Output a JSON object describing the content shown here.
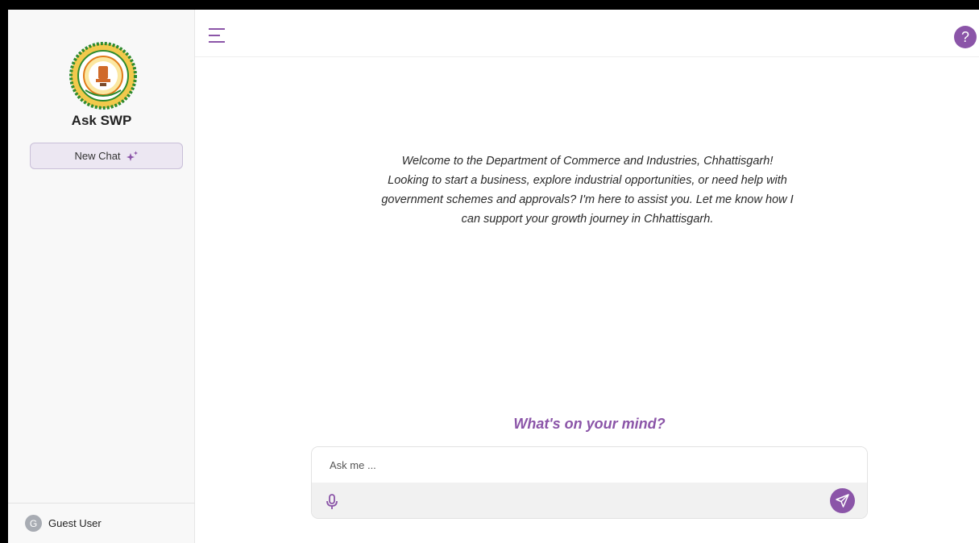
{
  "app": {
    "title": "Ask SWP",
    "new_chat_label": "New Chat"
  },
  "user": {
    "initial": "G",
    "name": "Guest User"
  },
  "header": {
    "help_symbol": "?"
  },
  "welcome": {
    "line1": "Welcome to the Department of Commerce and Industries, Chhattisgarh!",
    "line2": "Looking to start a business, explore industrial opportunities, or need help with",
    "line3": "government schemes and approvals? I'm here to assist you. Let me know how I",
    "line4": "can support your growth journey in Chhattisgarh."
  },
  "composer": {
    "heading": "What's on your mind?",
    "placeholder": "Ask me ..."
  },
  "colors": {
    "accent": "#8b55a8",
    "sidebar_bg": "#f8f8f8",
    "new_chat_bg": "#ece7f2"
  },
  "icons": {
    "menu": "hamburger-menu-icon",
    "help": "question-mark-icon",
    "new_chat": "sparkle-icon",
    "mic": "microphone-icon",
    "send": "paper-plane-icon"
  }
}
